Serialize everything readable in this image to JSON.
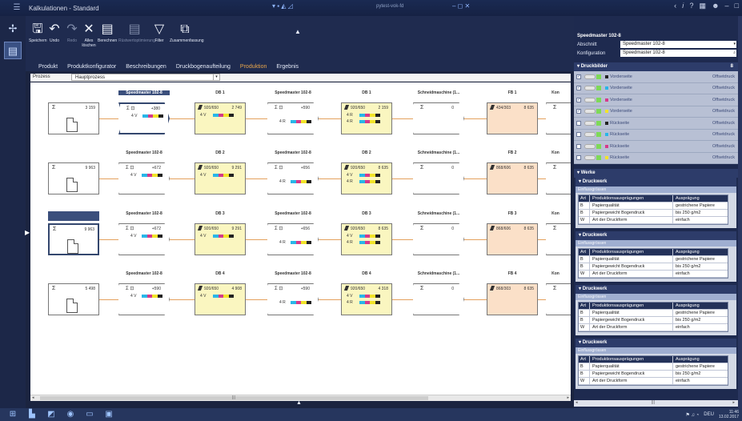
{
  "window": {
    "title": "Kalkulationen - Standard",
    "center_tab": "pytest-vok-fd",
    "controls": [
      "–",
      "□",
      "×"
    ]
  },
  "toolbar": {
    "buttons": [
      {
        "label": "Speichern",
        "icon": "save-icon",
        "glyph": "🖫",
        "enabled": true
      },
      {
        "label": "Undo",
        "icon": "undo-icon",
        "glyph": "↶",
        "enabled": true
      },
      {
        "label": "Redo",
        "icon": "redo-icon",
        "glyph": "↷",
        "enabled": false
      },
      {
        "label": "Alles löschen",
        "icon": "clear-all-icon",
        "glyph": "✕",
        "enabled": true
      },
      {
        "label": "Berechnen",
        "icon": "calculate-icon",
        "glyph": "▤",
        "enabled": true
      },
      {
        "label": "Rüstwertoptimierung",
        "icon": "optimize-icon",
        "glyph": "▤",
        "enabled": false
      },
      {
        "label": "Filter",
        "icon": "filter-icon",
        "glyph": "▽",
        "enabled": true
      },
      {
        "label": "Zusammenfassung",
        "icon": "summary-icon",
        "glyph": "⧉",
        "enabled": true
      }
    ]
  },
  "tabs": [
    {
      "label": "Produkt",
      "active": false
    },
    {
      "label": "Produktkonfigurator",
      "active": false
    },
    {
      "label": "Beschreibungen",
      "active": false
    },
    {
      "label": "Druckbogenaufteilung",
      "active": false
    },
    {
      "label": "Produktion",
      "active": true
    },
    {
      "label": "Ergebnis",
      "active": false
    }
  ],
  "process": {
    "label": "Prozess",
    "value": "Hauptprozess"
  },
  "rows": [
    {
      "source_value": "3 159",
      "press": {
        "title": "Speedmaster 102-8",
        "count": "+380",
        "colors": "4 V"
      },
      "db": {
        "title": "DB 1",
        "fmt": "920/650",
        "num": "2 749",
        "colors1": "4 V"
      },
      "press2": {
        "title": "Speedmaster 102-8",
        "count": "+590",
        "colors": "4 R"
      },
      "db2": {
        "title": "DB 1",
        "fmt": "920/650",
        "num": "2 159",
        "colors1": "4 R"
      },
      "cut": {
        "title": "Schneidmaschine (1...",
        "value": "0"
      },
      "fb": {
        "title": "FB 1",
        "fmt": "434/303",
        "num": "8 635"
      }
    },
    {
      "source_value": "9 963",
      "press": {
        "title": "Speedmaster 102-8",
        "count": "+672",
        "colors": "4 V"
      },
      "db": {
        "title": "DB 2",
        "fmt": "920/650",
        "num": "9 291",
        "colors1": "4 V"
      },
      "press2": {
        "title": "Speedmaster 102-8",
        "count": "+656",
        "colors": "4 R"
      },
      "db2": {
        "title": "DB 2",
        "fmt": "920/650",
        "num": "8 635",
        "colors1": "4 V"
      },
      "cut": {
        "title": "Schneidmaschine (1...",
        "value": "0"
      },
      "fb": {
        "title": "FB 2",
        "fmt": "868/606",
        "num": "8 635"
      }
    },
    {
      "source_value": "9 963",
      "press": {
        "title": "Speedmaster 102-8",
        "count": "+672",
        "colors": "4 V"
      },
      "db": {
        "title": "DB 3",
        "fmt": "920/650",
        "num": "9 291",
        "colors1": "4 V"
      },
      "press2": {
        "title": "Speedmaster 102-8",
        "count": "+656",
        "colors": "4 R"
      },
      "db2": {
        "title": "DB 3",
        "fmt": "920/650",
        "num": "8 635",
        "colors1": "4 V"
      },
      "cut": {
        "title": "Schneidmaschine (1...",
        "value": "0"
      },
      "fb": {
        "title": "FB 3",
        "fmt": "868/606",
        "num": "8 635"
      }
    },
    {
      "source_value": "5 498",
      "press": {
        "title": "Speedmaster 102-8",
        "count": "+590",
        "colors": "4 V"
      },
      "db": {
        "title": "DB 4",
        "fmt": "920/650",
        "num": "4 908",
        "colors1": "4 V"
      },
      "press2": {
        "title": "Speedmaster 102-8",
        "count": "+590",
        "colors": "4 R"
      },
      "db2": {
        "title": "DB 4",
        "fmt": "920/650",
        "num": "4 318",
        "colors1": "4 V"
      },
      "cut": {
        "title": "Schneidmaschine (1...",
        "value": "0"
      },
      "fb": {
        "title": "FB 4",
        "fmt": "868/303",
        "num": "8 635"
      }
    }
  ],
  "row_extra": {
    "db2_colors2": "4 R",
    "kon_label": "Kon"
  },
  "panel": {
    "title": "Speedmaster 102-8",
    "fields": [
      {
        "label": "Abschnitt",
        "value": "Speedmaster 102-8"
      },
      {
        "label": "Konfiguration",
        "value": "Speedmaster 102-8"
      }
    ],
    "druckbilder": {
      "label": "Druckbilder",
      "count": "8",
      "items": [
        {
          "checked": true,
          "side": "Vorderseite",
          "tech": "Offsetdruck",
          "swatch": "#222222"
        },
        {
          "checked": true,
          "side": "Vorderseite",
          "tech": "Offsetdruck",
          "swatch": "#29b6e8"
        },
        {
          "checked": true,
          "side": "Vorderseite",
          "tech": "Offsetdruck",
          "swatch": "#d63a8a"
        },
        {
          "checked": true,
          "side": "Vorderseite",
          "tech": "Offsetdruck",
          "swatch": "#f2e32a"
        },
        {
          "checked": false,
          "side": "Rückseite",
          "tech": "Offsetdruck",
          "swatch": "#222222"
        },
        {
          "checked": false,
          "side": "Rückseite",
          "tech": "Offsetdruck",
          "swatch": "#29b6e8"
        },
        {
          "checked": false,
          "side": "Rückseite",
          "tech": "Offsetdruck",
          "swatch": "#d63a8a"
        },
        {
          "checked": false,
          "side": "Rückseite",
          "tech": "Offsetdruck",
          "swatch": "#f2e32a"
        }
      ]
    },
    "werke_label": "Werke",
    "druckwerk_label": "Druckwerk",
    "einflussgroessen_label": "Einflussgrössen",
    "table_headers": [
      "Art",
      "Produktionsausprägungen",
      "Ausprägung"
    ],
    "table_rows": [
      [
        "B",
        "Papierqualität",
        "gestrichene Papiere"
      ],
      [
        "B",
        "Papiergewicht Bogendruck",
        "bis 250 g/m2"
      ],
      [
        "W",
        "Art der Druckform",
        "einfach"
      ]
    ]
  },
  "taskbar": {
    "lang": "DEU",
    "time": "11:46",
    "date": "13.02.2017"
  }
}
